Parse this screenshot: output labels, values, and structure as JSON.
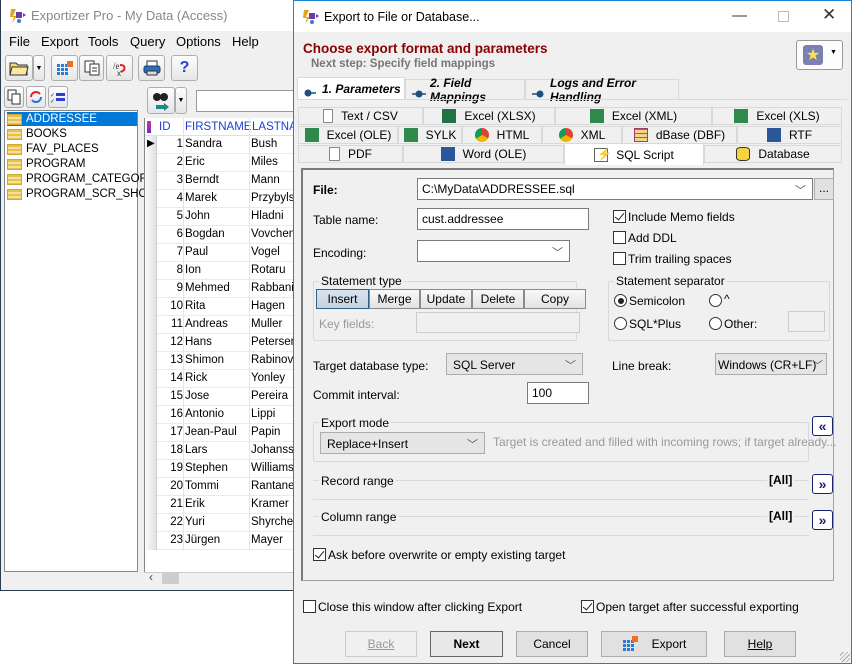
{
  "main_window": {
    "title": "Exportizer Pro - My Data (Access)",
    "menu": [
      "File",
      "Export",
      "Tools",
      "Query",
      "Options",
      "Help"
    ],
    "toolbar_icons": [
      "open-folder-icon",
      "dropdown-arrow-icon",
      "export-grid-icon",
      "copy-icon",
      "expression-icon",
      "print-icon",
      "help-icon"
    ],
    "tree_toolbar_icons": [
      "copy-icon",
      "refresh-icon",
      "checklist-icon"
    ],
    "search_placeholder": "",
    "tables": [
      {
        "name": "ADDRESSEE",
        "selected": true
      },
      {
        "name": "BOOKS",
        "selected": false
      },
      {
        "name": "FAV_PLACES",
        "selected": false
      },
      {
        "name": "PROGRAM",
        "selected": false
      },
      {
        "name": "PROGRAM_CATEGORY",
        "selected": false
      },
      {
        "name": "PROGRAM_SCR_SHOT",
        "selected": false
      }
    ],
    "grid": {
      "columns": [
        "ID",
        "FIRSTNAME",
        "LASTNAME"
      ],
      "rows": [
        {
          "id": "1",
          "first": "Sandra",
          "last": "Bush"
        },
        {
          "id": "2",
          "first": "Eric",
          "last": "Miles"
        },
        {
          "id": "3",
          "first": "Berndt",
          "last": "Mann"
        },
        {
          "id": "4",
          "first": "Marek",
          "last": "Przybylski"
        },
        {
          "id": "5",
          "first": "John",
          "last": "Hladni"
        },
        {
          "id": "6",
          "first": "Bogdan",
          "last": "Vovchenko"
        },
        {
          "id": "7",
          "first": "Paul",
          "last": "Vogel"
        },
        {
          "id": "8",
          "first": "Ion",
          "last": "Rotaru"
        },
        {
          "id": "9",
          "first": "Mehmed",
          "last": "Rabbani"
        },
        {
          "id": "10",
          "first": "Rita",
          "last": "Hagen"
        },
        {
          "id": "11",
          "first": "Andreas",
          "last": "Muller"
        },
        {
          "id": "12",
          "first": "Hans",
          "last": "Petersen"
        },
        {
          "id": "13",
          "first": "Shimon",
          "last": "Rabinovich"
        },
        {
          "id": "14",
          "first": "Rick",
          "last": "Yonley"
        },
        {
          "id": "15",
          "first": "Jose",
          "last": "Pereira"
        },
        {
          "id": "16",
          "first": "Antonio",
          "last": "Lippi"
        },
        {
          "id": "17",
          "first": "Jean-Paul",
          "last": "Papin"
        },
        {
          "id": "18",
          "first": "Lars",
          "last": "Johansson"
        },
        {
          "id": "19",
          "first": "Stephen",
          "last": "Williams"
        },
        {
          "id": "20",
          "first": "Tommi",
          "last": "Rantanen"
        },
        {
          "id": "21",
          "first": "Erik",
          "last": "Kramer"
        },
        {
          "id": "22",
          "first": "Yuri",
          "last": "Shyrchenko"
        },
        {
          "id": "23",
          "first": "Jürgen",
          "last": "Mayer"
        }
      ]
    }
  },
  "dialog": {
    "title": "Export to File or Database...",
    "heading": "Choose export format and parameters",
    "subheading": "Next step: Specify field mappings",
    "step_tabs": [
      {
        "label": "1. Parameters",
        "active": true
      },
      {
        "label": "2. Field Mappings",
        "active": false
      },
      {
        "label": "Logs and Error Handling",
        "active": false
      }
    ],
    "format_tabs": {
      "row1": [
        "Text / CSV",
        "Excel (XLSX)",
        "Excel (XML)",
        "Excel (XLS)"
      ],
      "row2": [
        "Excel (OLE)",
        "SYLK",
        "HTML",
        "XML",
        "dBase (DBF)",
        "RTF"
      ],
      "row3": [
        "PDF",
        "Word (OLE)",
        "SQL Script",
        "Database"
      ],
      "active": "SQL Script"
    },
    "form": {
      "file_label": "File:",
      "file_value": "C:\\MyData\\ADDRESSEE.sql",
      "browse_label": "...",
      "table_name_label": "Table name:",
      "table_name_value": "cust.addressee",
      "encoding_label": "Encoding:",
      "encoding_value": "",
      "include_memo_label": "Include Memo fields",
      "include_memo_checked": true,
      "add_ddl_label": "Add DDL",
      "add_ddl_checked": false,
      "trim_label": "Trim trailing spaces",
      "trim_checked": false,
      "statement_type_label": "Statement type",
      "statement_types": [
        "Insert",
        "Merge",
        "Update",
        "Delete",
        "Copy"
      ],
      "statement_type_selected": "Insert",
      "key_fields_label": "Key fields:",
      "key_fields_value": "",
      "separator_label": "Statement separator",
      "separators": [
        "Semicolon",
        "^",
        "SQL*Plus",
        "Other:"
      ],
      "separator_selected": "Semicolon",
      "other_value": "",
      "target_db_label": "Target database type:",
      "target_db_value": "SQL Server",
      "line_break_label": "Line break:",
      "line_break_value": "Windows (CR+LF)",
      "commit_label": "Commit interval:",
      "commit_value": "100",
      "export_mode_label": "Export mode",
      "export_mode_value": "Replace+Insert",
      "export_mode_desc": "Target is created and filled with incoming rows; if target already...",
      "record_range_label": "Record range",
      "record_range_value": "[All]",
      "column_range_label": "Column range",
      "column_range_value": "[All]",
      "ask_overwrite_label": "Ask before overwrite or empty existing target",
      "ask_overwrite_checked": true
    },
    "close_after_label": "Close this window after clicking Export",
    "close_after_checked": false,
    "open_target_label": "Open target after successful exporting",
    "open_target_checked": true,
    "buttons": {
      "back": "Back",
      "next": "Next",
      "cancel": "Cancel",
      "export": "Export",
      "help": "Help"
    }
  }
}
